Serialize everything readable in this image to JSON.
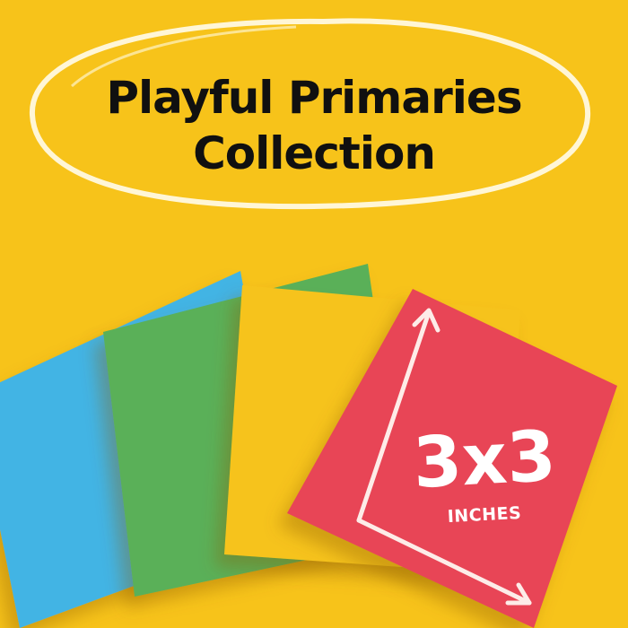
{
  "title_line_1": "Playful Primaries",
  "title_line_2": "Collection",
  "size_label": "3x3",
  "size_unit": "INCHES",
  "colors": {
    "background": "#f7c31a",
    "blue_note": "#42b4e4",
    "green_note": "#5ab058",
    "yellow_note": "#f6c31c",
    "red_note": "#e84556"
  }
}
